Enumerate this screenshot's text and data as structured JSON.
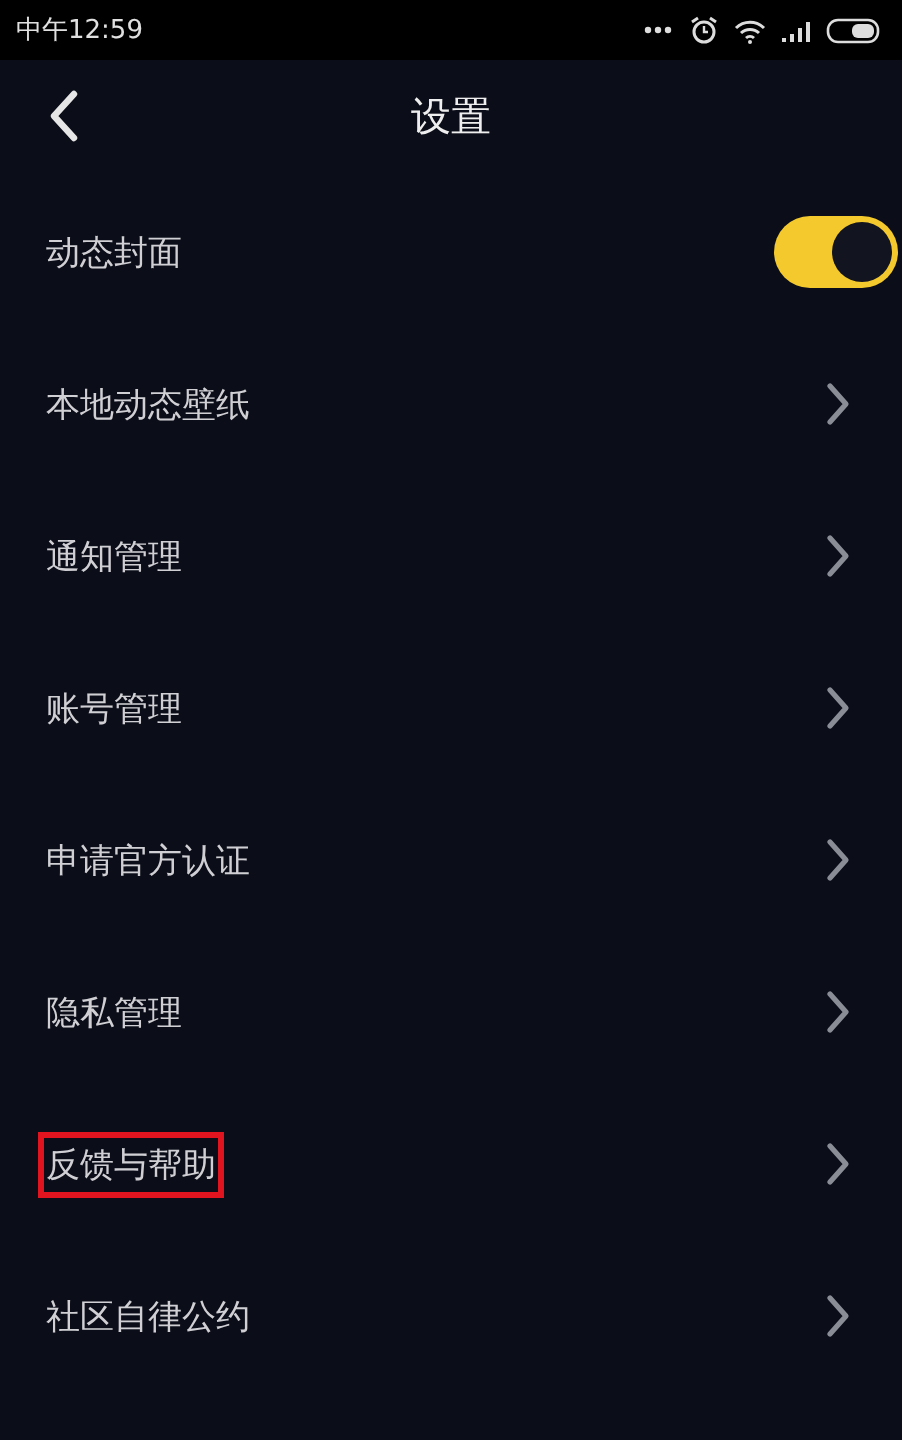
{
  "status_bar": {
    "time": "中午12:59"
  },
  "header": {
    "title": "设置"
  },
  "items": [
    {
      "label": "动态封面",
      "kind": "toggle",
      "on": true,
      "highlighted": false
    },
    {
      "label": "本地动态壁纸",
      "kind": "link",
      "highlighted": false
    },
    {
      "label": "通知管理",
      "kind": "link",
      "highlighted": false
    },
    {
      "label": "账号管理",
      "kind": "link",
      "highlighted": false
    },
    {
      "label": "申请官方认证",
      "kind": "link",
      "highlighted": false
    },
    {
      "label": "隐私管理",
      "kind": "link",
      "highlighted": false
    },
    {
      "label": "反馈与帮助",
      "kind": "link",
      "highlighted": true
    },
    {
      "label": "社区自律公约",
      "kind": "link",
      "highlighted": false
    }
  ]
}
